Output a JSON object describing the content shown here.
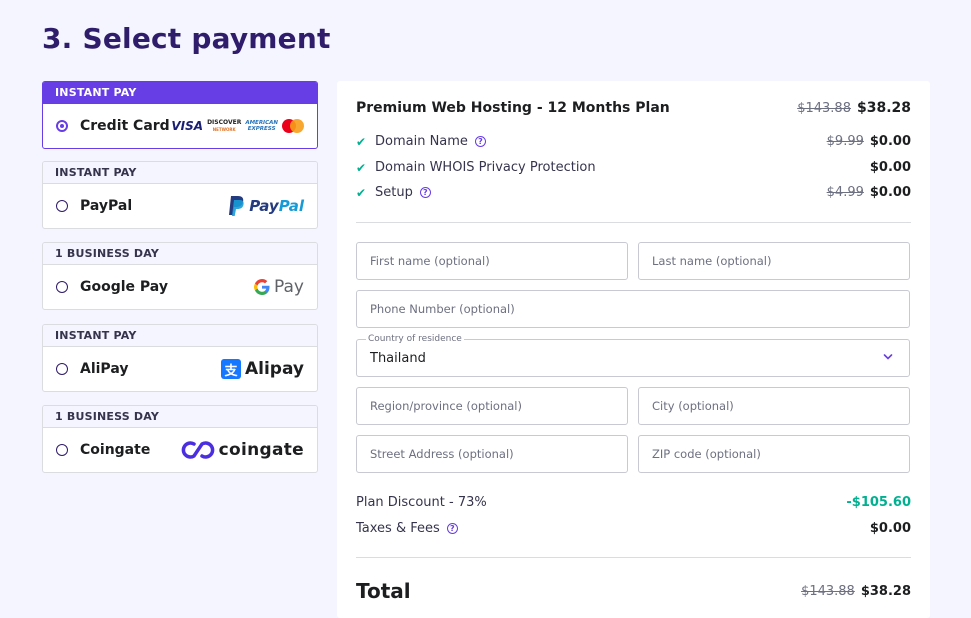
{
  "page": {
    "heading": "3. Select payment"
  },
  "payment_methods": [
    {
      "tag": "INSTANT PAY",
      "label": "Credit Card",
      "selected": true,
      "icon": "credit-card-logos"
    },
    {
      "tag": "INSTANT PAY",
      "label": "PayPal",
      "selected": false,
      "icon": "paypal-logo"
    },
    {
      "tag": "1 BUSINESS DAY",
      "label": "Google Pay",
      "selected": false,
      "icon": "google-pay-logo"
    },
    {
      "tag": "INSTANT PAY",
      "label": "AliPay",
      "selected": false,
      "icon": "alipay-logo"
    },
    {
      "tag": "1 BUSINESS DAY",
      "label": "Coingate",
      "selected": false,
      "icon": "coingate-logo"
    }
  ],
  "logos": {
    "visa": "VISA",
    "discover": "DISCOVER",
    "discover_sub": "NETWORK",
    "amex_1": "AMERICAN",
    "amex_2": "EXPRESS",
    "paypal_1": "Pay",
    "paypal_2": "Pal",
    "gpay": "Pay",
    "alipay": "Alipay",
    "coingate": "coingate"
  },
  "order": {
    "plan": {
      "title": "Premium Web Hosting - 12 Months Plan",
      "old_price": "$143.88",
      "price": "$38.28"
    },
    "items": [
      {
        "label": "Domain Name",
        "help": true,
        "old_price": "$9.99",
        "price": "$0.00"
      },
      {
        "label": "Domain WHOIS Privacy Protection",
        "help": false,
        "old_price": "",
        "price": "$0.00"
      },
      {
        "label": "Setup",
        "help": true,
        "old_price": "$4.99",
        "price": "$0.00"
      }
    ]
  },
  "form": {
    "first_name_placeholder": "First name (optional)",
    "last_name_placeholder": "Last name (optional)",
    "phone_placeholder": "Phone Number (optional)",
    "country_label": "Country of residence",
    "country_value": "Thailand",
    "region_placeholder": "Region/province (optional)",
    "city_placeholder": "City (optional)",
    "street_placeholder": "Street Address (optional)",
    "zip_placeholder": "ZIP code (optional)"
  },
  "summary": {
    "discount_label": "Plan Discount - 73%",
    "discount_value": "-$105.60",
    "taxes_label": "Taxes & Fees",
    "taxes_value": "$0.00",
    "total_label": "Total",
    "total_old": "$143.88",
    "total_value": "$38.28"
  },
  "colors": {
    "accent": "#673de6",
    "heading": "#2f1c6a",
    "success": "#00b090",
    "background": "#f4f5ff"
  }
}
